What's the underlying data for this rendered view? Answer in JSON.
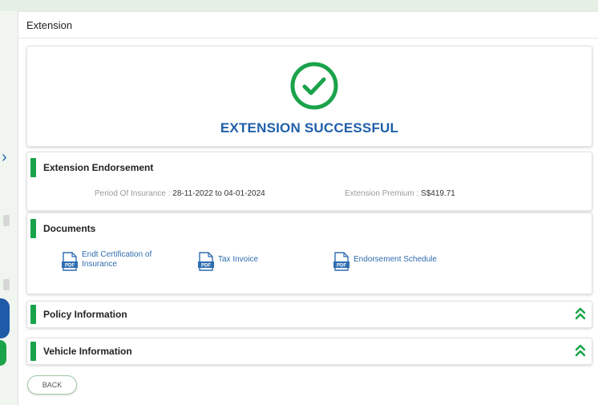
{
  "page": {
    "title": "Extension"
  },
  "success": {
    "title": "EXTENSION SUCCESSFUL",
    "icon": "check-circle-icon",
    "color": "#1aa34a"
  },
  "endorsement": {
    "heading": "Extension Endorsement",
    "period_label": "Period Of Insurance :",
    "period_value": "28-11-2022 to 04-01-2024",
    "premium_label": "Extension Premium :",
    "premium_value": "S$419.71"
  },
  "documents": {
    "heading": "Documents",
    "items": [
      {
        "label": "Endt Certification of Insurance",
        "icon": "pdf-icon"
      },
      {
        "label": "Tax Invoice",
        "icon": "pdf-icon"
      },
      {
        "label": "Endorsement Schedule",
        "icon": "pdf-icon"
      }
    ]
  },
  "sections": [
    {
      "label": "Policy Information",
      "icon": "double-chevron-up-icon"
    },
    {
      "label": "Vehicle Information",
      "icon": "double-chevron-up-icon"
    }
  ],
  "actions": {
    "back_label": "BACK"
  },
  "colors": {
    "accent_green": "#17a34a",
    "title_blue": "#1f5fa8",
    "link_blue": "#2f6db0"
  }
}
